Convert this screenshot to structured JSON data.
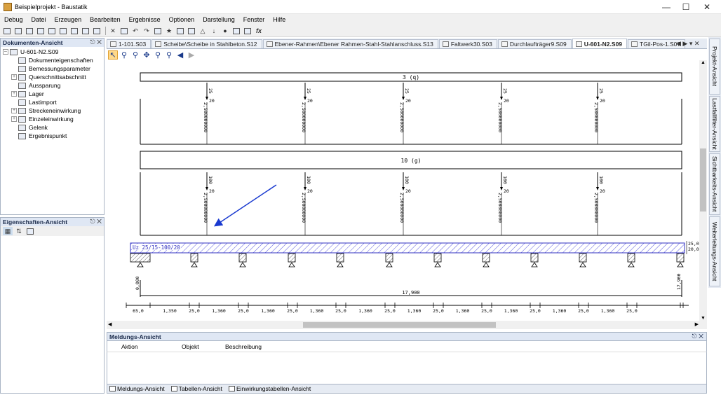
{
  "app": {
    "title": "Beispielprojekt - Baustatik"
  },
  "menu": [
    "Debug",
    "Datei",
    "Erzeugen",
    "Bearbeiten",
    "Ergebnisse",
    "Optionen",
    "Darstellung",
    "Fenster",
    "Hilfe"
  ],
  "doc_view": {
    "title": "Dokumenten-Ansicht",
    "root": "U-601-N2.S09",
    "items": [
      {
        "label": "Dokumenteigenschaften",
        "expand": false
      },
      {
        "label": "Bemessungsparameter",
        "expand": false
      },
      {
        "label": "Querschnittsabschnitt",
        "expand": true
      },
      {
        "label": "Aussparung",
        "expand": false
      },
      {
        "label": "Lager",
        "expand": true
      },
      {
        "label": "Lastimport",
        "expand": false
      },
      {
        "label": "Streckeneinwirkung",
        "expand": true
      },
      {
        "label": "Einzeleinwirkung",
        "expand": true
      },
      {
        "label": "Gelenk",
        "expand": false
      },
      {
        "label": "Ergebnispunkt",
        "expand": false
      }
    ]
  },
  "prop_view": {
    "title": "Eigenschaften-Ansicht"
  },
  "tabs": [
    {
      "label": "1-101.S03",
      "active": false
    },
    {
      "label": "Scheibe\\Scheibe in Stahlbeton.S12",
      "active": false
    },
    {
      "label": "Ebener-Rahmen\\Ebener Rahmen-Stahl-Stahlanschluss.S13",
      "active": false
    },
    {
      "label": "Faltwerk30.S03",
      "active": false
    },
    {
      "label": "Durchlaufträger9.S09",
      "active": false
    },
    {
      "label": "U-601-N2.S09",
      "active": true
    },
    {
      "label": "TGil-Pos-1.S07",
      "active": false
    }
  ],
  "right_tabs": [
    "Projekt-Ansicht",
    "Lastfallfilter-Ansicht",
    "Sichtbarkeits-Ansicht",
    "Weiterleitungs-Ansicht"
  ],
  "drawing": {
    "load_q": "3 (q)",
    "load_g": "10 (g)",
    "section_label": "Uz 25/15-100/20",
    "point_top_value": "25",
    "point_top_sub": "20",
    "point_bottom_value": "100",
    "point_bottom_sub": "20",
    "top_vertical_labels": [
      "2,500000000",
      "2,500000000",
      "2,500000000",
      "2,500000000",
      "2,500000000"
    ],
    "bottom_vertical_labels": [
      "2,500000000",
      "2,500000000",
      "2,500000000",
      "2,500000000",
      "2,500000000"
    ],
    "right_dim_top": "25,0",
    "right_dim_bottom": "20,0",
    "total_left": "0,000",
    "total_span": "17,900",
    "total_right": "17,900",
    "dims": [
      "65,0",
      "1,350",
      "25,0",
      "1,360",
      "25,0",
      "1,360",
      "25,0",
      "1,360",
      "25,0",
      "1,360",
      "25,0",
      "1,360",
      "25,0",
      "1,360",
      "25,0",
      "1,360",
      "25,0",
      "1,360",
      "25,0",
      "1,360",
      "25,0"
    ]
  },
  "messages": {
    "title": "Meldungs-Ansicht",
    "columns": [
      "Aktion",
      "Objekt",
      "Beschreibung"
    ]
  },
  "bottom_tabs": [
    "Meldungs-Ansicht",
    "Tabellen-Ansicht",
    "Einwirkungstabellen-Ansicht"
  ]
}
